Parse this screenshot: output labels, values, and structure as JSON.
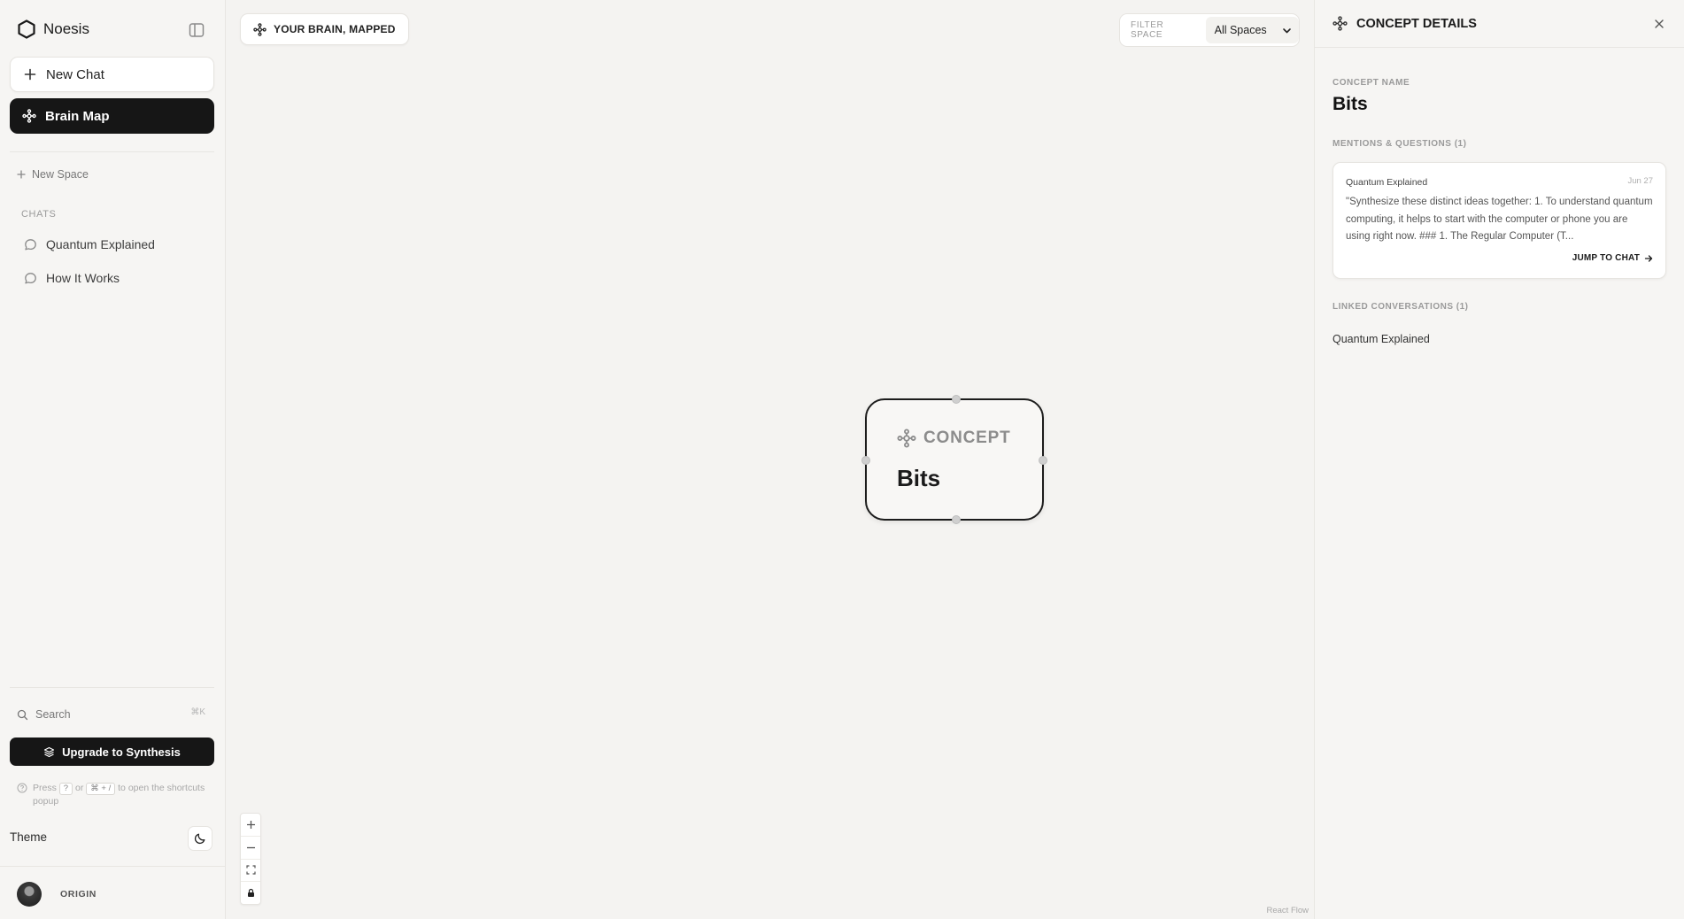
{
  "app": {
    "name": "Noesis"
  },
  "sidebar": {
    "new_chat_label": "New Chat",
    "brain_map_label": "Brain Map",
    "new_space_label": "New Space",
    "chats_header": "CHATS",
    "chats": [
      {
        "label": "Quantum Explained"
      },
      {
        "label": "How It Works"
      }
    ],
    "search_placeholder": "Search",
    "search_shortcut": "⌘K",
    "upgrade_label": "Upgrade to Synthesis",
    "hint": {
      "press": "Press",
      "key1": "?",
      "or": "or",
      "key2": "⌘ + /",
      "tail": "to open the shortcuts popup"
    },
    "theme_label": "Theme",
    "user_name": "ORIGIN"
  },
  "canvas": {
    "header_label": "YOUR BRAIN, MAPPED",
    "filter_label": "FILTER SPACE",
    "filter_value": "All Spaces",
    "node": {
      "type_label": "CONCEPT",
      "label": "Bits"
    },
    "attribution": "React Flow"
  },
  "details": {
    "title": "CONCEPT DETAILS",
    "concept_name_label": "CONCEPT NAME",
    "concept_name": "Bits",
    "mentions_label": "MENTIONS & QUESTIONS (1)",
    "mentions": [
      {
        "source": "Quantum Explained",
        "date": "Jun 27",
        "text": "\"Synthesize these distinct ideas together: 1. To understand quantum computing, it helps to start with the computer or phone you are using right now. ### 1. The Regular Computer (T...",
        "action": "JUMP TO CHAT"
      }
    ],
    "linked_label": "LINKED CONVERSATIONS (1)",
    "linked": [
      {
        "label": "Quantum Explained"
      }
    ]
  }
}
